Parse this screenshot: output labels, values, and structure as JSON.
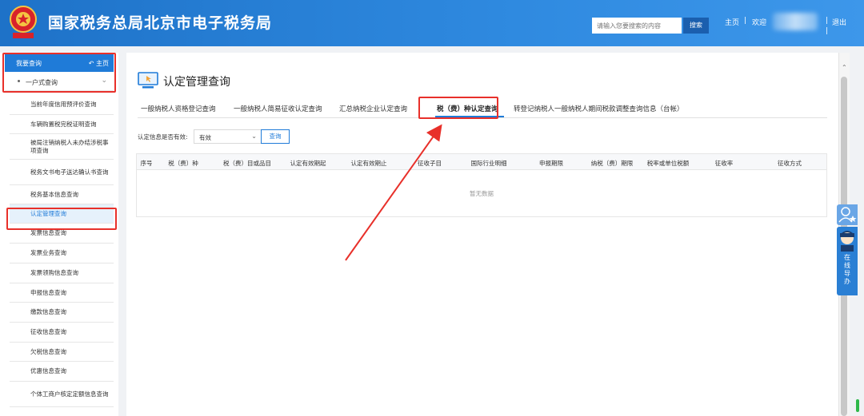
{
  "header": {
    "title": "国家税务总局北京市电子税务局",
    "search_placeholder": "请输入您要搜索的内容",
    "search_button": "搜索",
    "home_link": "主页",
    "welcome_text": "欢迎",
    "logout_link": "退出",
    "separator": "|"
  },
  "sidebar": {
    "header_label": "我要查询",
    "header_home": "主页",
    "group_label": "一户式查询",
    "items": [
      {
        "label": "当前年度信用预评价查询"
      },
      {
        "label": "车辆购置税完税证明查询"
      },
      {
        "label": "被局注销纳税人未办结涉税事项查询"
      },
      {
        "label": "税务文书电子送达确认书查询"
      },
      {
        "label": "税务基本信息查询"
      },
      {
        "label": "认定管理查询"
      },
      {
        "label": "发票信息查询"
      },
      {
        "label": "发票业务查询"
      },
      {
        "label": "发票领购信息查询"
      },
      {
        "label": "申报信息查询"
      },
      {
        "label": "缴款信息查询"
      },
      {
        "label": "征收信息查询"
      },
      {
        "label": "欠税信息查询"
      },
      {
        "label": "优惠信息查询"
      },
      {
        "label": "个体工商户核定定额信息查询"
      }
    ],
    "active_index": 5
  },
  "main": {
    "page_title": "认定管理查询",
    "tabs": [
      {
        "label": "一般纳税人资格登记查询"
      },
      {
        "label": "一般纳税人简易征收认定查询"
      },
      {
        "label": "汇总纳税企业认定查询"
      },
      {
        "label": "税（费）种认定查询"
      },
      {
        "label": "转登记纳税人一般纳税人期间税款调整查询信息（台帐）"
      }
    ],
    "active_tab_index": 3,
    "filter": {
      "label": "认定信息是否有效:",
      "selected": "有效",
      "query_button": "查询"
    },
    "table": {
      "columns": [
        "序号",
        "税（费）种",
        "税（费）目或品目",
        "认定有效期起",
        "认定有效期止",
        "征收子目",
        "国际行业明细",
        "申报期限",
        "纳税（费）期限",
        "税率或单位税额",
        "征收率",
        "征收方式"
      ],
      "empty_text": "暂无数据"
    }
  },
  "side_tool": {
    "assistant_label": "在线导办"
  },
  "colors": {
    "header_blue": "#1e72c8",
    "accent_blue": "#1f7bd8",
    "annotation_red": "#e8302a"
  }
}
